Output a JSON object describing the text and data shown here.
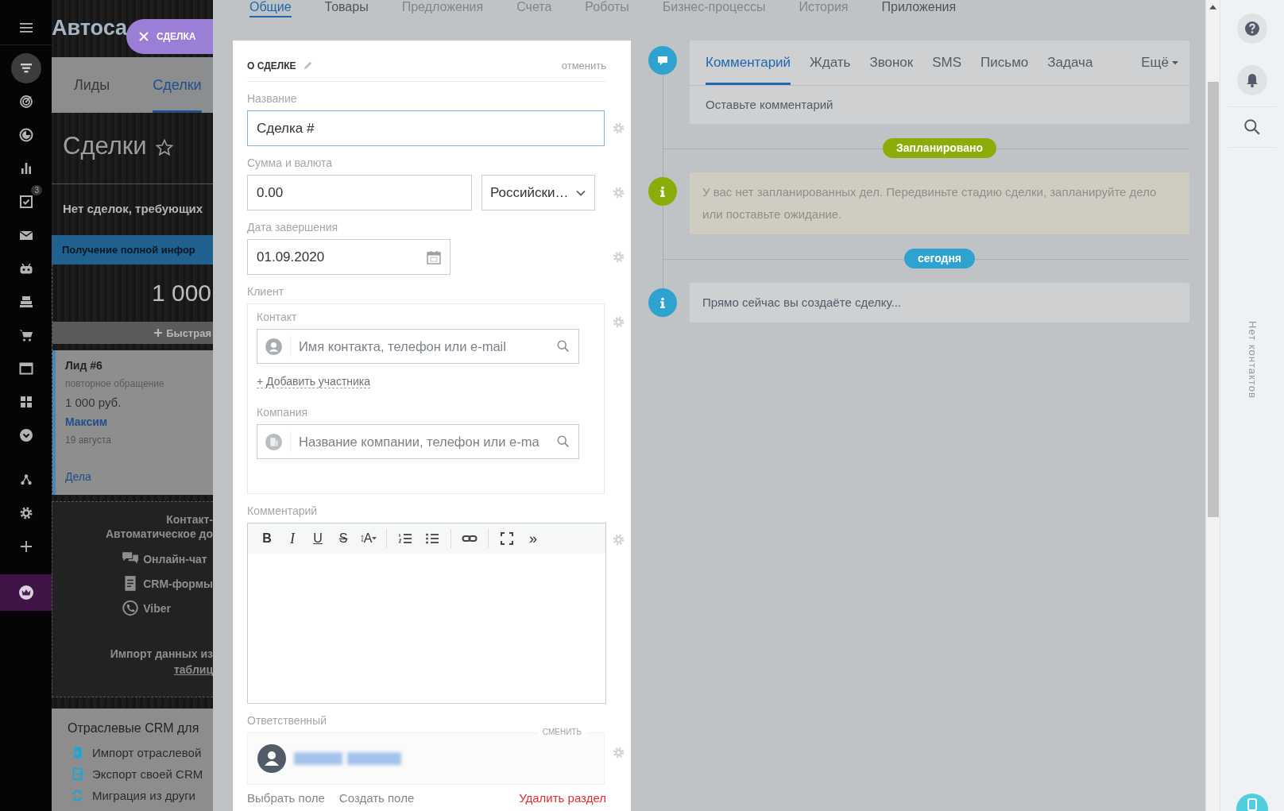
{
  "sidebar": {
    "items": [
      {
        "selected": false,
        "highlighted": false
      },
      {
        "selected": true,
        "highlighted": false
      },
      {
        "selected": false,
        "highlighted": false
      },
      {
        "selected": false,
        "highlighted": false
      },
      {
        "selected": false,
        "highlighted": false
      },
      {
        "selected": false,
        "highlighted": false,
        "badge": "3"
      },
      {
        "selected": false,
        "highlighted": false
      },
      {
        "selected": false,
        "highlighted": false
      },
      {
        "selected": false,
        "highlighted": false
      },
      {
        "selected": false,
        "highlighted": false
      },
      {
        "selected": false,
        "highlighted": false
      },
      {
        "selected": false,
        "highlighted": false
      },
      {
        "selected": false,
        "highlighted": false
      },
      {
        "selected": false,
        "highlighted": false
      },
      {
        "selected": false,
        "highlighted": false
      },
      {
        "selected": false,
        "highlighted": false
      },
      {
        "selected": false,
        "highlighted": true
      }
    ]
  },
  "crm": {
    "title": "Автоса",
    "tabs": [
      {
        "label": "Лиды",
        "selected": false
      },
      {
        "label": "Сделки",
        "selected": true
      }
    ],
    "heading": "Сделки",
    "notice": "Нет сделок, требующих",
    "column": {
      "stage": "Получение полной инфор",
      "total": "1 000",
      "quick_add": "Быстрая"
    },
    "lead": {
      "title": "Лид #6",
      "source": "повторное обращение",
      "amount": "1 000 руб.",
      "contact": "Максим",
      "date": "19 августа",
      "activities": "Дела"
    },
    "promo": {
      "title": "Контакт-",
      "subtitle": "Автоматическое до",
      "channels": [
        "Онлайн-чат",
        "CRM-формы",
        "Viber"
      ],
      "import_text": "Импорт данных из",
      "import_link": "таблиц"
    },
    "industry": {
      "title": "Отраслевые CRM для",
      "links": [
        "Импорт отраслевой",
        "Экспорт своей CRM",
        "Миграция из други"
      ]
    }
  },
  "deal_chip": {
    "label": "СДЕЛКА"
  },
  "panel": {
    "tabs": [
      {
        "label": "Общие",
        "selected": true,
        "disabled": false
      },
      {
        "label": "Товары",
        "selected": false,
        "disabled": false
      },
      {
        "label": "Предложения",
        "selected": false,
        "disabled": true
      },
      {
        "label": "Счета",
        "selected": false,
        "disabled": true
      },
      {
        "label": "Роботы",
        "selected": false,
        "disabled": true
      },
      {
        "label": "Бизнес-процессы",
        "selected": false,
        "disabled": true
      },
      {
        "label": "История",
        "selected": false,
        "disabled": true
      },
      {
        "label": "Приложения",
        "selected": false,
        "disabled": false
      }
    ]
  },
  "form": {
    "title": "О СДЕЛКЕ",
    "cancel": "отменить",
    "name": {
      "label": "Название",
      "value": "Сделка #",
      "focused": true
    },
    "amount": {
      "label": "Сумма и валюта",
      "value": "0.00",
      "focused": false,
      "currency": "Российски…"
    },
    "close_date": {
      "label": "Дата завершения",
      "value": "01.09.2020",
      "focused": false
    },
    "client": {
      "label": "Клиент",
      "contact_label": "Контакт",
      "contact_placeholder": "Имя контакта, телефон или e-mail",
      "add_participant": "+ Добавить участника",
      "company_label": "Компания",
      "company_placeholder": "Название компании, телефон или e-ma"
    },
    "comment": {
      "label": "Комментарий",
      "toolbar_groups": [
        [
          {
            "kind": "bold",
            "label": "B"
          },
          {
            "kind": "italic",
            "label": "I"
          },
          {
            "kind": "underline",
            "label": "U"
          },
          {
            "kind": "strike",
            "label": "S"
          },
          {
            "kind": "font-size",
            "label": "A"
          }
        ],
        [
          {
            "kind": "ordered-list"
          },
          {
            "kind": "bullet-list"
          }
        ],
        [
          {
            "kind": "link"
          }
        ],
        [
          {
            "kind": "fullscreen"
          },
          {
            "kind": "more",
            "label": "»"
          }
        ]
      ]
    },
    "responsible": {
      "label": "Ответственный",
      "change": "СМЕНИТЬ"
    },
    "footer": {
      "select_field": "Выбрать поле",
      "create_field": "Создать поле",
      "delete_section": "Удалить раздел"
    }
  },
  "timeline": {
    "tabs": [
      {
        "label": "Комментарий",
        "selected": true
      },
      {
        "label": "Ждать",
        "selected": false
      },
      {
        "label": "Звонок",
        "selected": false
      },
      {
        "label": "SMS",
        "selected": false
      },
      {
        "label": "Письмо",
        "selected": false
      },
      {
        "label": "Задача",
        "selected": false
      }
    ],
    "more": "Ещё",
    "comment_placeholder": "Оставьте комментарий",
    "entries": [
      {
        "kind": "badge",
        "label": "Запланировано",
        "color": "#8aad0a"
      },
      {
        "kind": "info",
        "text": "У вас нет запланированных дел. Передвиньте стадию сделки, запланируйте дело или поставьте ожидание.",
        "color": "#8aad0a",
        "highlighted": true
      },
      {
        "kind": "badge",
        "label": "сегодня",
        "color": "#2ea3d0"
      },
      {
        "kind": "info",
        "text": "Прямо сейчас вы создаёте сделку...",
        "color": "#2ea3d0",
        "highlighted": false
      }
    ]
  },
  "right_bar": {
    "empty_text": "Нет контактов"
  }
}
